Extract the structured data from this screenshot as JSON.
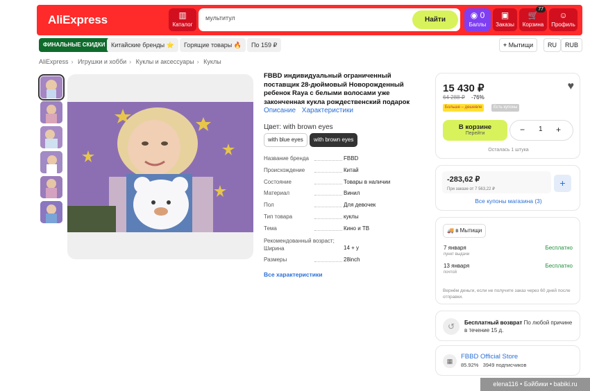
{
  "header": {
    "logo": "AliExpress",
    "catalog": "Каталог",
    "search_value": "мультитул",
    "search_button": "Найти",
    "points_count": "0",
    "points": "Баллы",
    "orders": "Заказы",
    "cart": "Корзина",
    "cart_count": "77",
    "profile": "Профиль"
  },
  "subnav": {
    "final_sale": "ФИНАЛЬНЫЕ СКИДКИ",
    "chinese_brands": "Китайские бренды ⭐",
    "hot_items": "Горящие товары 🔥",
    "under_159": "По 159 ₽",
    "location": "Мытищи",
    "lang": "RU",
    "currency": "RUB"
  },
  "breadcrumbs": [
    "AliExpress",
    "Игрушки и хобби",
    "Куклы и аксессуары",
    "Куклы"
  ],
  "product": {
    "title": "FBBD индивидуальный ограниченный поставщик 28-дюймовый Новорожденный ребенок Raya с белыми волосами уже законченная кукла рождественский подарок",
    "tab_description": "Описание",
    "tab_specs": "Характеристики",
    "color_label": "Цвет: with brown eyes",
    "options": [
      "with blue eyes",
      "with brown eyes"
    ],
    "specs": [
      {
        "k": "Название бренда",
        "v": "FBBD"
      },
      {
        "k": "Происхождение",
        "v": "Китай"
      },
      {
        "k": "Состояние",
        "v": "Товары в наличии"
      },
      {
        "k": "Материал",
        "v": "Винил"
      },
      {
        "k": "Пол",
        "v": "Для девочек"
      },
      {
        "k": "Тип товара",
        "v": "куклы"
      },
      {
        "k": "Тема",
        "v": "Кино и ТВ"
      },
      {
        "k": "Рекомендованный возраст; Ширина",
        "v": "14 + у"
      },
      {
        "k": "Размеры",
        "v": "28inch"
      }
    ],
    "all_specs": "Все характеристики"
  },
  "buy": {
    "price": "15 430 ₽",
    "old_price": "64 288 ₽",
    "discount": "-76%",
    "badge_more_cheaper": "Больше – дешевле",
    "badge_coupons": "Есть купоны",
    "in_cart": "В корзине",
    "go": "Перейти",
    "qty": "1",
    "stock_left": "Осталась 1 штука"
  },
  "coupon": {
    "amount": "-283,62 ₽",
    "condition": "При заказе от 7 563,22 ₽",
    "all": "Все купоны магазина (3)"
  },
  "shipping": {
    "city": "в Мытищи",
    "options": [
      {
        "date": "7 января",
        "type": "пункт выдачи",
        "price": "Бесплатно"
      },
      {
        "date": "13 января",
        "type": "почтой",
        "price": "Бесплатно"
      }
    ],
    "refund_note": "Вернём деньги, если не получите заказ через 60 дней после отправки."
  },
  "return": {
    "title": "Бесплатный возврат",
    "text": "По любой причине в течение 15 д."
  },
  "store": {
    "name": "FBBD Official Store",
    "rating": "85.92%",
    "subscribers": "3949 подписчиков"
  },
  "watermark": "elena116 • Бэйбики • babiki.ru",
  "colors": {
    "header_red": "#ff2a2a",
    "accent_lime": "#d8f25c",
    "link_blue": "#2a6fd6",
    "final_green": "#0f6b2c"
  }
}
